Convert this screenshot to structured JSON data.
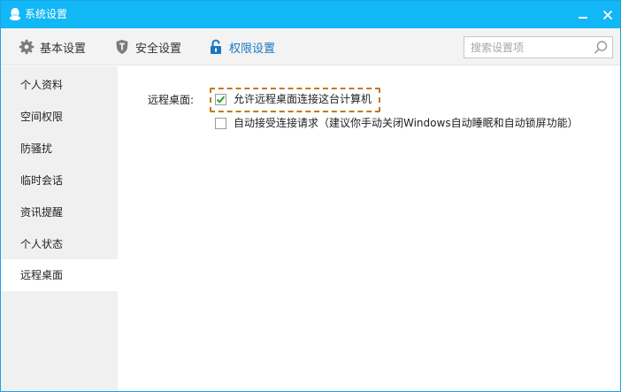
{
  "window": {
    "title": "系统设置",
    "accent_color": "#12b7f5"
  },
  "toolbar": {
    "tabs": [
      {
        "label": "基本设置",
        "icon": "gear-icon"
      },
      {
        "label": "安全设置",
        "icon": "shield-icon"
      },
      {
        "label": "权限设置",
        "icon": "lock-icon",
        "active": true
      }
    ],
    "search": {
      "placeholder": "搜索设置项",
      "value": ""
    }
  },
  "sidebar": {
    "items": [
      {
        "label": "个人资料"
      },
      {
        "label": "空间权限"
      },
      {
        "label": "防骚扰"
      },
      {
        "label": "临时会话"
      },
      {
        "label": "资讯提醒"
      },
      {
        "label": "个人状态"
      },
      {
        "label": "远程桌面",
        "active": true
      }
    ]
  },
  "content": {
    "section_label": "远程桌面:",
    "options": [
      {
        "label": "允许远程桌面连接这台计算机",
        "checked": true
      },
      {
        "label": "自动接受连接请求（建议你手动关闭Windows自动睡眠和自动锁屏功能）",
        "checked": false
      }
    ],
    "highlight_color": "#c07a18"
  }
}
